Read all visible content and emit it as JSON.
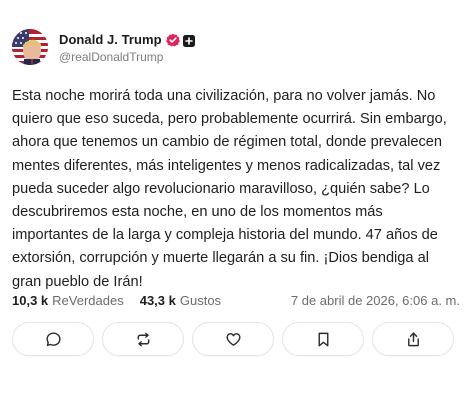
{
  "post": {
    "author": {
      "display_name": "Donald J. Trump",
      "handle": "@realDonaldTrump",
      "verified_icon": "verified-badge-icon",
      "badge_icon": "plus-badge-icon"
    },
    "text": "Esta noche morirá toda una civilización, para no volver jamás. No quiero que eso suceda, pero probablemente ocurrirá. Sin embargo, ahora que tenemos un cambio de régimen total, donde prevalecen mentes diferentes, más inteligentes y menos radicalizadas, tal vez pueda suceder algo revolucionario maravilloso, ¿quién sabe? Lo descubriremos esta noche, en uno de los momentos más importantes de la larga y compleja historia del mundo. 47 años de extorsión, corrupción y muerte llegarán a su fin. ¡Dios bendiga al gran pueblo de Irán!",
    "stats": {
      "reposts_count": "10,3 k",
      "reposts_label": "ReVerdades",
      "likes_count": "43,3 k",
      "likes_label": "Gustos"
    },
    "timestamp": "7 de abril de 2026, 6:06 a. m."
  },
  "actions": [
    {
      "name": "reply-button",
      "icon": "comment-icon"
    },
    {
      "name": "repost-button",
      "icon": "repost-icon"
    },
    {
      "name": "like-button",
      "icon": "heart-icon"
    },
    {
      "name": "bookmark-button",
      "icon": "bookmark-icon"
    },
    {
      "name": "share-button",
      "icon": "share-icon"
    }
  ],
  "colors": {
    "verified": "#e0245e",
    "text": "#1e1e1e",
    "muted": "#6b6b70",
    "border": "#e4e4e7"
  }
}
